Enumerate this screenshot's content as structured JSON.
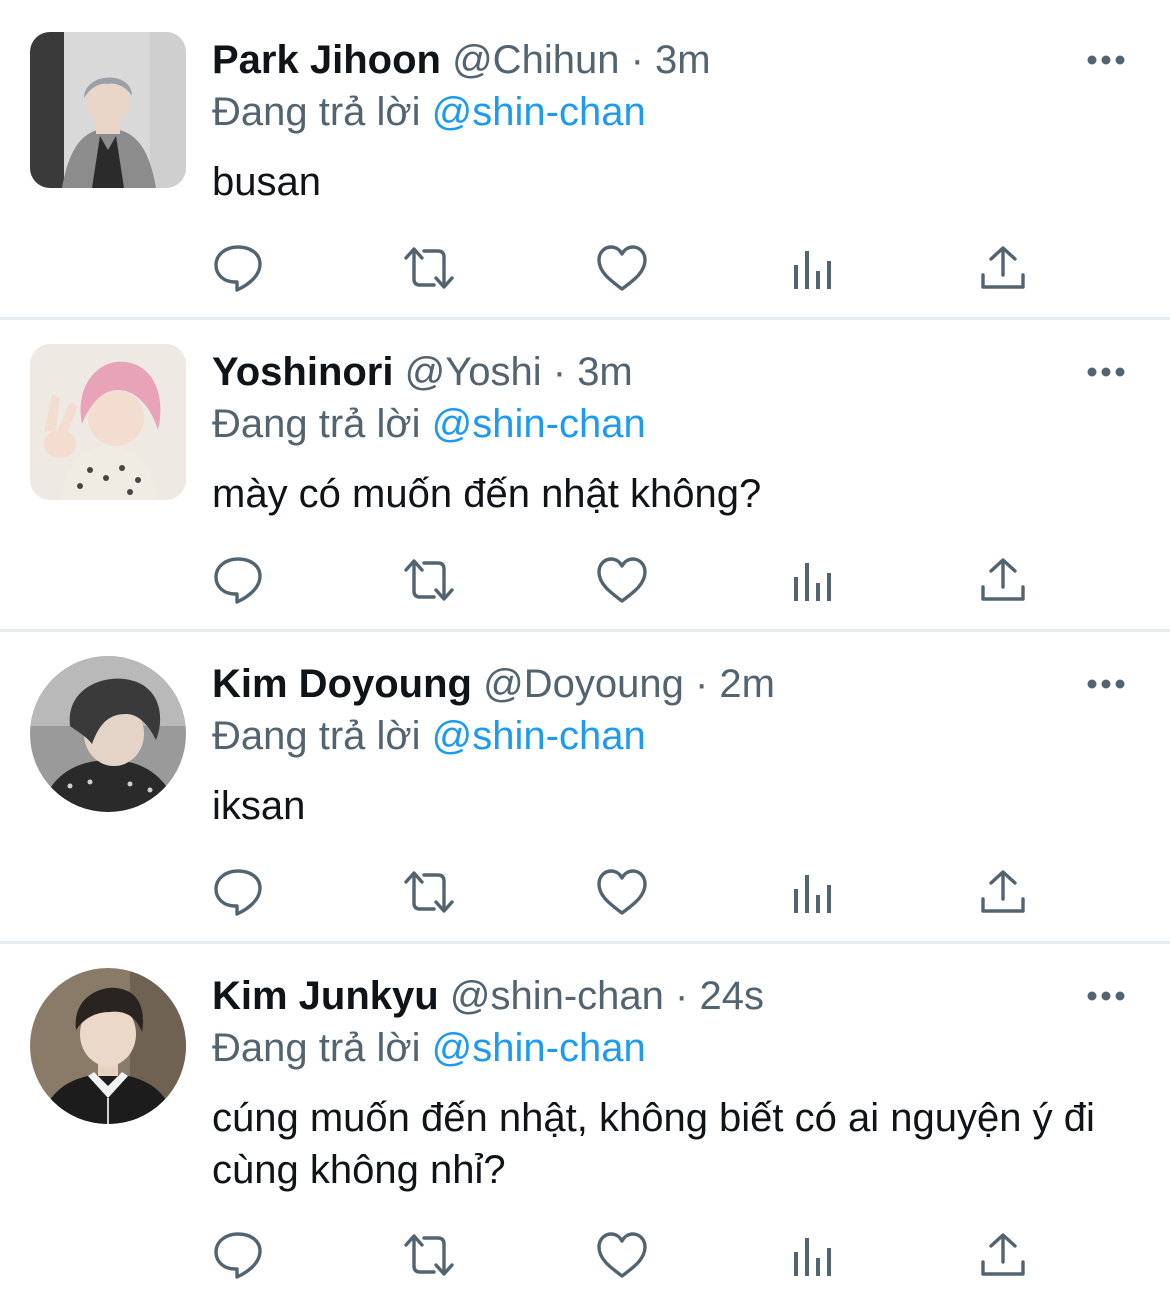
{
  "tweets": [
    {
      "name": "Park Jihoon",
      "handle": "@Chihun",
      "separator": "·",
      "time": "3m",
      "reply_prefix": "Đang trả lời",
      "reply_mention": "@shin-chan",
      "text": "busan"
    },
    {
      "name": "Yoshinori",
      "handle": "@Yoshi",
      "separator": "·",
      "time": "3m",
      "reply_prefix": "Đang trả lời",
      "reply_mention": "@shin-chan",
      "text": "mày có muốn đến nhật không?"
    },
    {
      "name": "Kim Doyoung",
      "handle": "@Doyoung",
      "separator": "·",
      "time": "2m",
      "reply_prefix": "Đang trả lời",
      "reply_mention": "@shin-chan",
      "text": "iksan"
    },
    {
      "name": "Kim Junkyu",
      "handle": "@shin-chan",
      "separator": "·",
      "time": "24s",
      "reply_prefix": "Đang trả lời",
      "reply_mention": "@shin-chan",
      "text": "cúng muốn đến nhật, không biết có ai nguyện ý đi cùng không nhỉ?"
    }
  ],
  "icons": {
    "more": "more-horizontal-icon",
    "reply": "reply-icon",
    "retweet": "retweet-icon",
    "like": "heart-icon",
    "analytics": "analytics-icon",
    "share": "share-icon"
  },
  "colors": {
    "name": "#0f1419",
    "secondary": "#536471",
    "mention": "#1d9bf0",
    "divider": "#e6ecf0"
  }
}
